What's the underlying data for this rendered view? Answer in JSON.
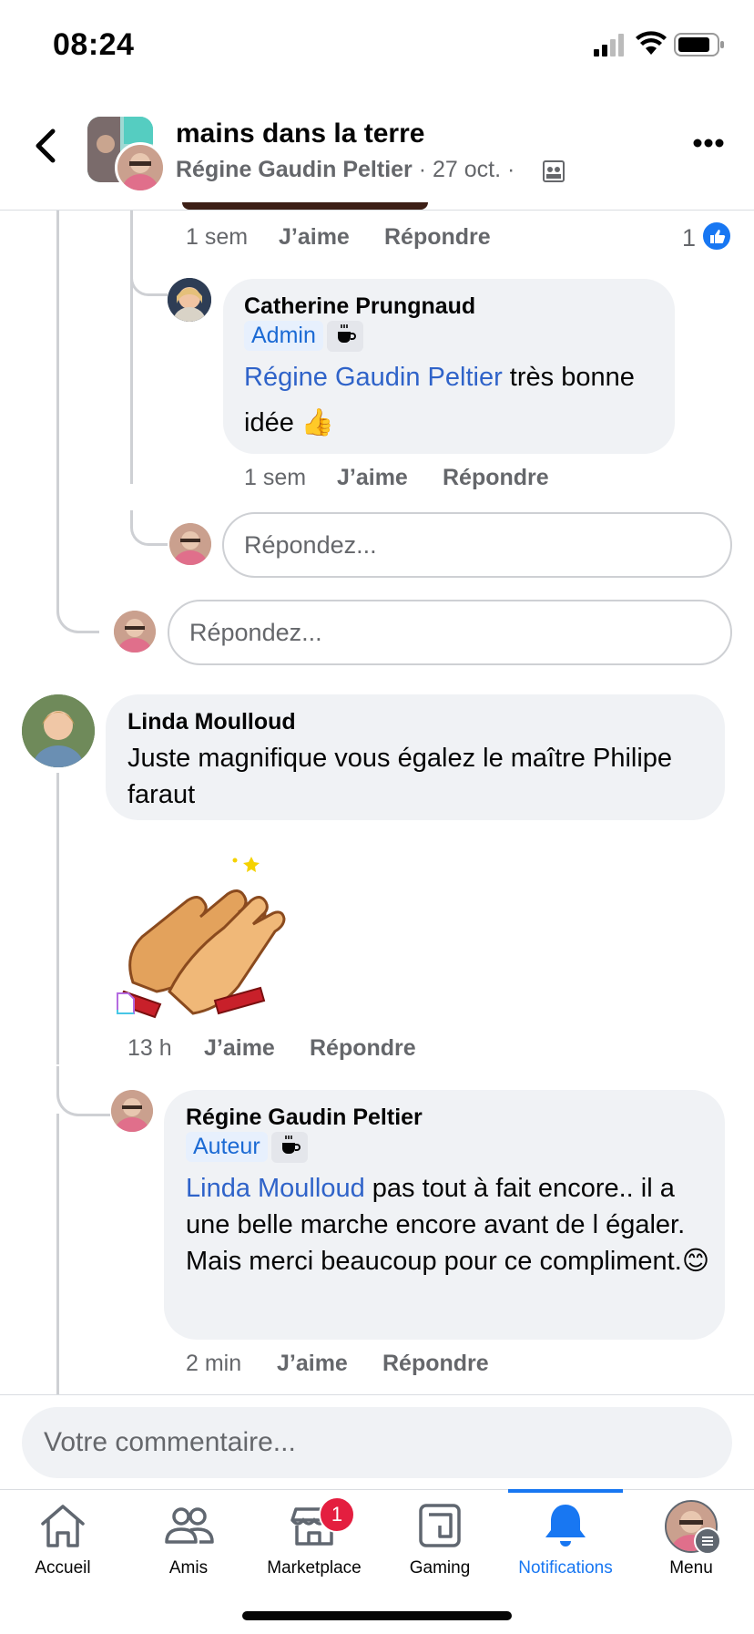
{
  "status_bar": {
    "time": "08:24"
  },
  "header": {
    "title": "mains dans la terre",
    "author": "Régine Gaudin Peltier",
    "date_sep": " · 27 oct. · "
  },
  "prev_comment_actions": {
    "time": "1 sem",
    "like": "J’aime",
    "reply": "Répondre",
    "reaction_count": "1"
  },
  "catherine_comment": {
    "name": "Catherine Prungnaud",
    "badge": "Admin",
    "mention": "Régine Gaudin Peltier",
    "text_after": " très bonne",
    "text_line2": "idée ",
    "emoji": "👍",
    "time": "1 sem",
    "like": "J’aime",
    "reply": "Répondre"
  },
  "reply_placeholder_1": "Répondez...",
  "reply_placeholder_2": "Répondez...",
  "linda_comment": {
    "name": "Linda Moulloud",
    "text": "Juste magnifique vous égalez le maître Philipe faraut",
    "time": "13 h",
    "like": "J’aime",
    "reply": "Répondre"
  },
  "regine_reply": {
    "name": "Régine Gaudin Peltier",
    "badge": "Auteur",
    "mention": "Linda Moulloud",
    "text_after": " pas tout à fait encore.. il a une belle marche encore avant de l égaler. Mais merci beaucoup pour ce compliment.",
    "emoji": "😊",
    "time": "2 min",
    "like": "J’aime",
    "reply": "Répondre"
  },
  "composer": {
    "placeholder": "Votre commentaire..."
  },
  "tabs": [
    {
      "label": "Accueil",
      "icon": "home-icon"
    },
    {
      "label": "Amis",
      "icon": "friends-icon"
    },
    {
      "label": "Marketplace",
      "icon": "marketplace-icon",
      "badge": "1"
    },
    {
      "label": "Gaming",
      "icon": "gaming-icon"
    },
    {
      "label": "Notifications",
      "icon": "bell-icon",
      "active": true
    },
    {
      "label": "Menu",
      "icon": "avatar"
    }
  ],
  "colors": {
    "accent": "#1877f2",
    "mention": "#2f63c9",
    "bubble": "#f0f2f5",
    "muted": "#65676b",
    "badge_red": "#e41e3f"
  }
}
